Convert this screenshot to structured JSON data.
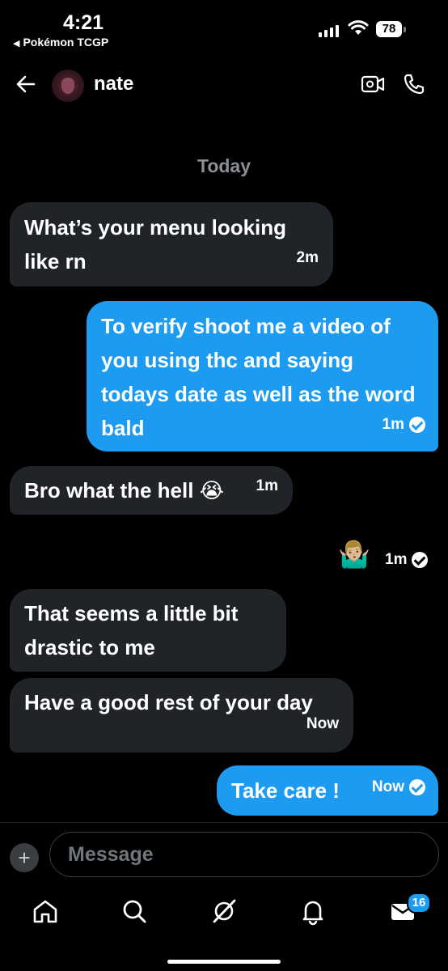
{
  "status_bar": {
    "time": "4:21",
    "back_app": "Pokémon TCGP",
    "battery": "78"
  },
  "header": {
    "contact_name": "nate"
  },
  "chat": {
    "date_separator": "Today",
    "messages": [
      {
        "direction": "incoming",
        "text": "What’s your menu looking like rn",
        "time": "2m"
      },
      {
        "direction": "outgoing",
        "text": "To verify shoot me a video of you using thc and saying todays date as well as the word bald",
        "time": "1m",
        "seen": true
      },
      {
        "direction": "incoming",
        "text": "Bro what the hell 😭",
        "time": "1m"
      },
      {
        "direction": "outgoing",
        "text": "🤷🏼‍♂️",
        "time": "1m",
        "seen": true
      },
      {
        "direction": "incoming",
        "text": "That seems a little bit drastic to me",
        "time": ""
      },
      {
        "direction": "incoming",
        "text": "Have a good rest of your day",
        "time": "Now"
      },
      {
        "direction": "outgoing",
        "text": "Take care !",
        "time": "Now",
        "seen": true
      }
    ]
  },
  "composer": {
    "placeholder": "Message"
  },
  "tabbar": {
    "items": [
      "home-icon",
      "search-icon",
      "grok-icon",
      "bell-icon",
      "mail-icon"
    ],
    "messages_badge": "16"
  },
  "colors": {
    "accent": "#1d9bf0",
    "incoming_bubble": "#202327",
    "background": "#000000"
  }
}
